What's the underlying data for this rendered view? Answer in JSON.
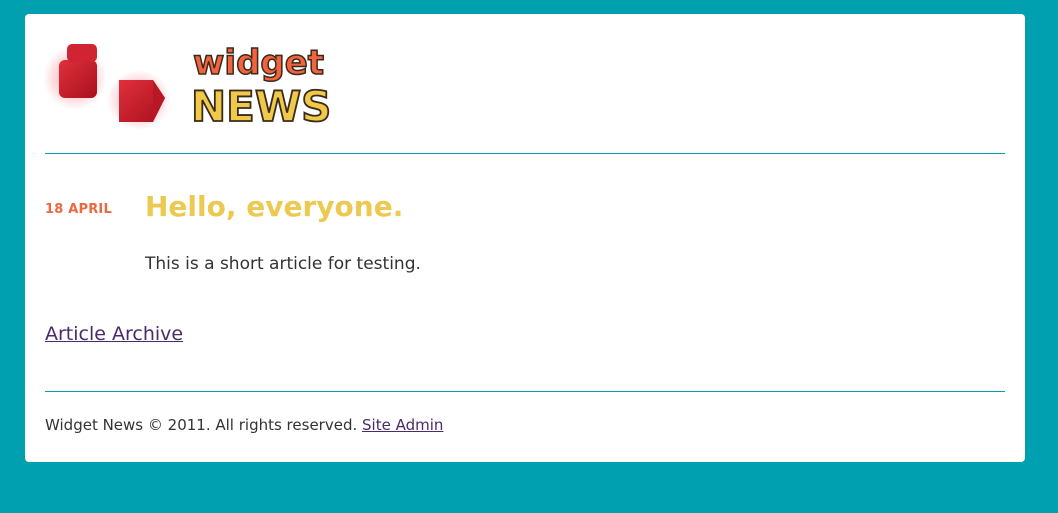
{
  "site": {
    "logo_alt": "Widget News",
    "logo_word_top": "widget",
    "logo_word_bottom": "NEWS"
  },
  "article": {
    "date": "18 APRIL",
    "title": "Hello, everyone.",
    "summary": "This is a short article for testing."
  },
  "links": {
    "archive": "Article Archive"
  },
  "footer": {
    "text": "Widget News © 2011. All rights reserved.",
    "admin_link": "Site Admin"
  },
  "colors": {
    "background": "#00a0b0",
    "date": "#eb6841",
    "title": "#edc951",
    "link": "#4a2a6a"
  }
}
